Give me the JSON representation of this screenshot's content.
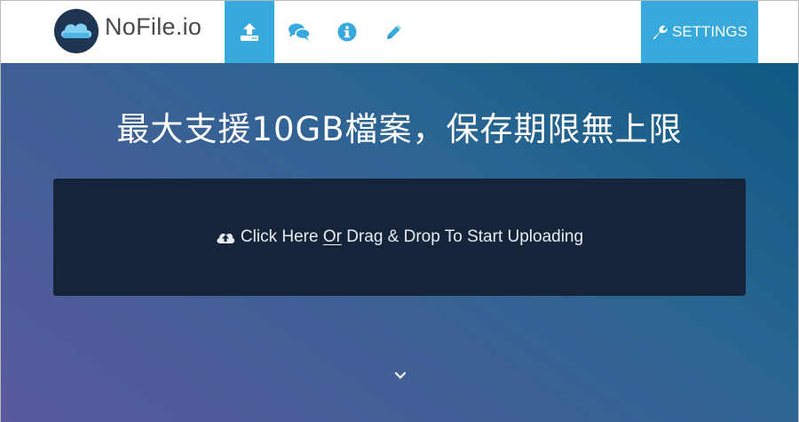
{
  "header": {
    "brand": "NoFile.io",
    "nav": [
      {
        "icon": "upload-icon",
        "active": true
      },
      {
        "icon": "comments-icon",
        "active": false
      },
      {
        "icon": "info-icon",
        "active": false
      },
      {
        "icon": "pencil-icon",
        "active": false
      }
    ],
    "settings_label": "SETTINGS",
    "settings_icon": "wrench-icon"
  },
  "hero": {
    "headline": "最大支援10GB檔案，保存期限無上限",
    "dropzone": {
      "icon": "cloud-upload-icon",
      "text_before": "Click Here",
      "text_link": "Or",
      "text_after": "Drag & Drop To Start Uploading"
    },
    "scroll_icon": "chevron-down-icon"
  },
  "colors": {
    "accent": "#38a9dc",
    "dropzone_bg": "#16243a",
    "logo_bg": "#1f3554"
  }
}
